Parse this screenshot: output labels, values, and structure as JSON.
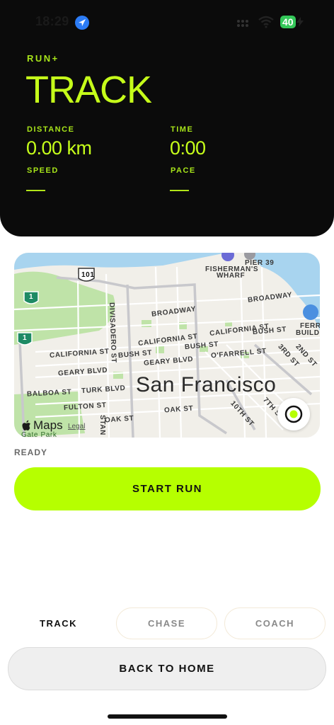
{
  "status_bar": {
    "time": "18:29",
    "battery": "40",
    "icons": [
      "location-arrow-icon",
      "cell-dots-icon",
      "wifi-icon",
      "charging-bolt-icon"
    ]
  },
  "header": {
    "brand": "RUN+",
    "title": "TRACK",
    "stats": {
      "distance_label": "DISTANCE",
      "distance_value": "0.00 km",
      "time_label": "TIME",
      "time_value": "0:00",
      "speed_label": "SPEED",
      "speed_value": "—",
      "pace_label": "PACE",
      "pace_value": "—"
    }
  },
  "map": {
    "city": "San Francisco",
    "attribution": "Maps",
    "legal": "Legal",
    "labels": {
      "pier": "PIER 39",
      "wharf1": "FISHERMAN'S",
      "wharf2": "WHARF",
      "hwy101": "101",
      "hwy1a": "1",
      "hwy1b": "1",
      "broadway": "BROADWAY",
      "broadway2": "BROADWAY",
      "california": "CALIFORNIA ST",
      "california2": "CALIFORNIA ST",
      "california3": "CALIFORNIA ST",
      "bush": "BUSH ST",
      "bush2": "BUSH ST",
      "bush3": "BUSH ST",
      "geary": "GEARY BLVD",
      "geary2": "GEARY BLVD",
      "ofarrell": "O'FARRELL ST",
      "balboa": "BALBOA ST",
      "turk": "TURK BLVD",
      "fulton": "FULTON ST",
      "oak": "OAK ST",
      "oak2": "OAK ST",
      "divisadero": "DIVISADERO ST",
      "third": "3RD ST",
      "second": "2ND ST",
      "tenth": "10TH ST",
      "seventh": "7TH ST",
      "ferry1": "FERRY",
      "ferry2": "BUILDIN",
      "gate": "Gate Park",
      "stan": "STAN"
    },
    "colors": {
      "land": "#f1efe9",
      "water": "#a8d4ef",
      "park": "#bfe3a8",
      "road": "#ffffff",
      "freeway": "#c8c8cc",
      "shield": "#1d8a64"
    }
  },
  "status_text": "READY",
  "start_button": "START RUN",
  "tabs": [
    {
      "label": "TRACK",
      "active": true
    },
    {
      "label": "CHASE",
      "active": false
    },
    {
      "label": "COACH",
      "active": false
    }
  ],
  "back_button": "BACK TO HOME",
  "colors": {
    "accent": "#c6ff1a",
    "start_button": "#b6ff00",
    "header_bg": "#0b0b0b",
    "battery": "#34c759",
    "location_blue": "#2c7cf6"
  }
}
